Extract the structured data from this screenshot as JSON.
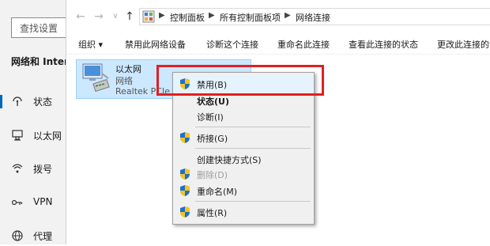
{
  "settings": {
    "search_label": "查找设置",
    "section_title": "网络和 Inter",
    "nav": [
      {
        "label": "状态",
        "icon": "home-status-icon",
        "selected": true
      },
      {
        "label": "以太网",
        "icon": "ethernet-icon"
      },
      {
        "label": "拨号",
        "icon": "dialup-icon"
      },
      {
        "label": "VPN",
        "icon": "vpn-icon"
      },
      {
        "label": "代理",
        "icon": "proxy-globe-icon"
      }
    ]
  },
  "explorer": {
    "breadcrumb": [
      "控制面板",
      "所有控制面板项",
      "网络连接"
    ],
    "toolbar": [
      "组织 ▾",
      "禁用此网络设备",
      "诊断这个连接",
      "重命名此连接",
      "查看此连接的状态",
      "更改此连接的设"
    ],
    "adapter": {
      "name": "以太网",
      "status": "网络",
      "device": "Realtek PCIe G"
    }
  },
  "context_menu": {
    "items": [
      {
        "label": "禁用(B)",
        "shield": true,
        "hover": true
      },
      {
        "label": "状态(U)",
        "bold": true
      },
      {
        "label": "诊断(I)"
      },
      {
        "label": "桥接(G)",
        "shield": true
      },
      {
        "label": "创建快捷方式(S)"
      },
      {
        "label": "删除(D)",
        "shield": true,
        "disabled": true
      },
      {
        "label": "重命名(M)",
        "shield": true
      },
      {
        "label": "属性(R)",
        "shield": true
      }
    ]
  },
  "colors": {
    "highlight": "#e02020",
    "selection": "#cce8ff",
    "accent": "#0067c0"
  }
}
